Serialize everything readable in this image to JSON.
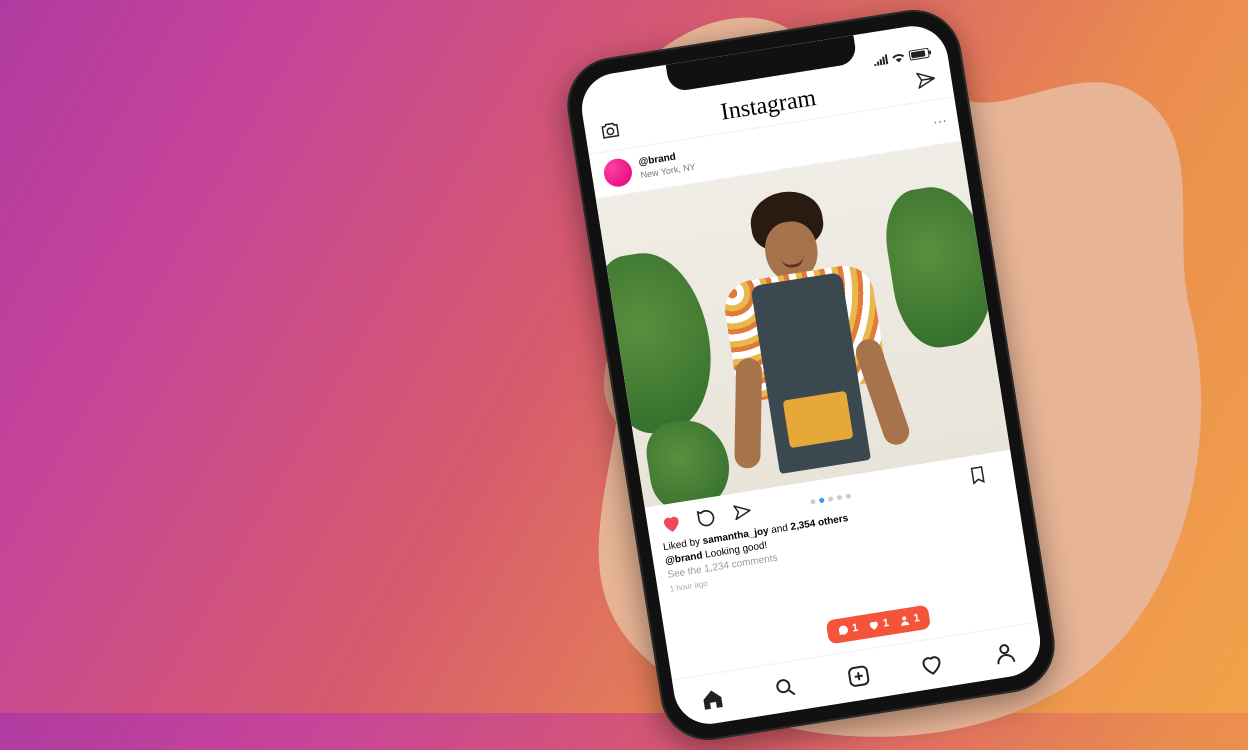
{
  "app": {
    "name": "Instagram"
  },
  "post": {
    "account": "@brand",
    "location": "New York, NY",
    "liked_by_prefix": "Liked by ",
    "liked_by_user": "samantha_joy",
    "liked_by_mid": " and ",
    "liked_by_count": "2,354 others",
    "caption_user": "@brand",
    "caption_text": " Looking good!",
    "see_all": "See the 1,234 comments",
    "time": "1 hour ago"
  },
  "notif": {
    "comments": "1",
    "likes": "1",
    "follows": "1"
  },
  "icons": {
    "camera": "camera",
    "send": "paper-plane",
    "more": "⋯",
    "heart": "heart",
    "comment": "speech-bubble",
    "share": "paper-plane",
    "bookmark": "bookmark",
    "home": "home",
    "search": "magnify",
    "add": "plus-square",
    "activity": "heart-outline",
    "profile": "person"
  }
}
